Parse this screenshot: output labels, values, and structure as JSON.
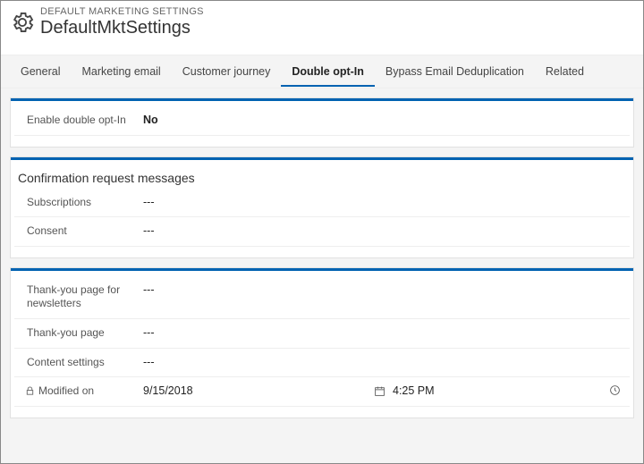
{
  "header": {
    "breadcrumb": "DEFAULT MARKETING SETTINGS",
    "title": "DefaultMktSettings"
  },
  "tabs": {
    "general": "General",
    "marketing_email": "Marketing email",
    "customer_journey": "Customer journey",
    "double_opt_in": "Double opt-In",
    "bypass_dedup": "Bypass Email Deduplication",
    "related": "Related"
  },
  "section1": {
    "enable_label": "Enable double opt-In",
    "enable_value": "No"
  },
  "section2": {
    "title": "Confirmation request messages",
    "subscriptions_label": "Subscriptions",
    "subscriptions_value": "---",
    "consent_label": "Consent",
    "consent_value": "---"
  },
  "section3": {
    "thankyou_news_label": "Thank-you page for newsletters",
    "thankyou_news_value": "---",
    "thankyou_label": "Thank-you page",
    "thankyou_value": "---",
    "content_settings_label": "Content settings",
    "content_settings_value": "---",
    "modified_label": "Modified on",
    "modified_date": "9/15/2018",
    "modified_time": "4:25 PM"
  }
}
